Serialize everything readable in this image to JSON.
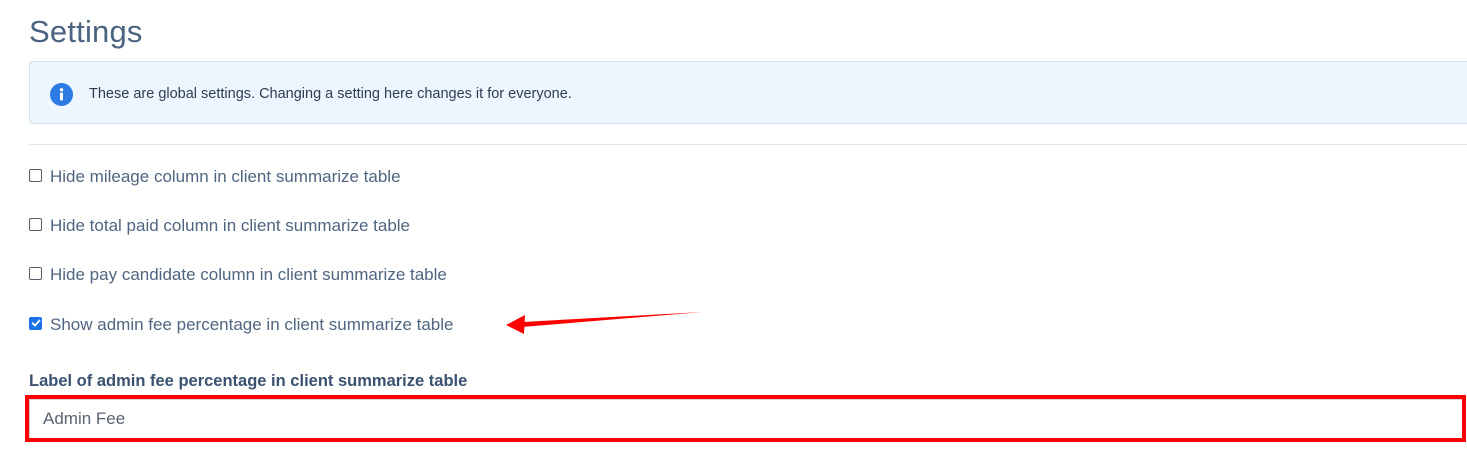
{
  "page": {
    "title": "Settings"
  },
  "alert": {
    "icon": "info-icon",
    "icon_color": "#2c7be5",
    "text": "These are global settings. Changing a setting here changes it for everyone."
  },
  "settings": {
    "checkboxes": [
      {
        "label": "Hide mileage column in client summarize table",
        "checked": false
      },
      {
        "label": "Hide total paid column in client summarize table",
        "checked": false
      },
      {
        "label": "Hide pay candidate column in client summarize table",
        "checked": false
      },
      {
        "label": "Show admin fee percentage in client summarize table",
        "checked": true
      }
    ],
    "admin_fee_label": {
      "label": "Label of admin fee percentage in client summarize table",
      "value": "Admin Fee"
    }
  },
  "annotations": {
    "arrow_color": "#ff0000",
    "highlight_color": "#ff0000"
  }
}
